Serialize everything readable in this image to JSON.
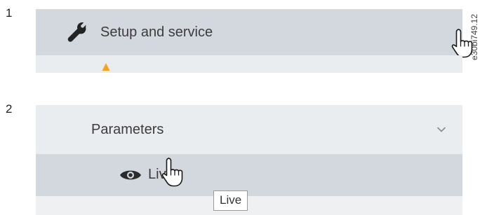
{
  "steps": [
    {
      "number": "1"
    },
    {
      "number": "2"
    }
  ],
  "figure_ref": "e30bi749.12",
  "panel1": {
    "menu_item": {
      "label": "Setup and service",
      "icon": "wrench-icon"
    },
    "partial_row_icon": "warning-icon",
    "colors": {
      "item_bg": "#d3d8de",
      "sub_bg": "#eaedf0",
      "warning": "#f2a51e"
    }
  },
  "panel2": {
    "section": {
      "label": "Parameters",
      "chevron": "chevron-down-icon"
    },
    "item": {
      "label": "Live",
      "icon": "eye-icon"
    },
    "tooltip": "Live",
    "colors": {
      "section_bg": "#eaedf0",
      "selected_bg": "#d3d8de",
      "next_bg": "#eef0f2"
    }
  }
}
